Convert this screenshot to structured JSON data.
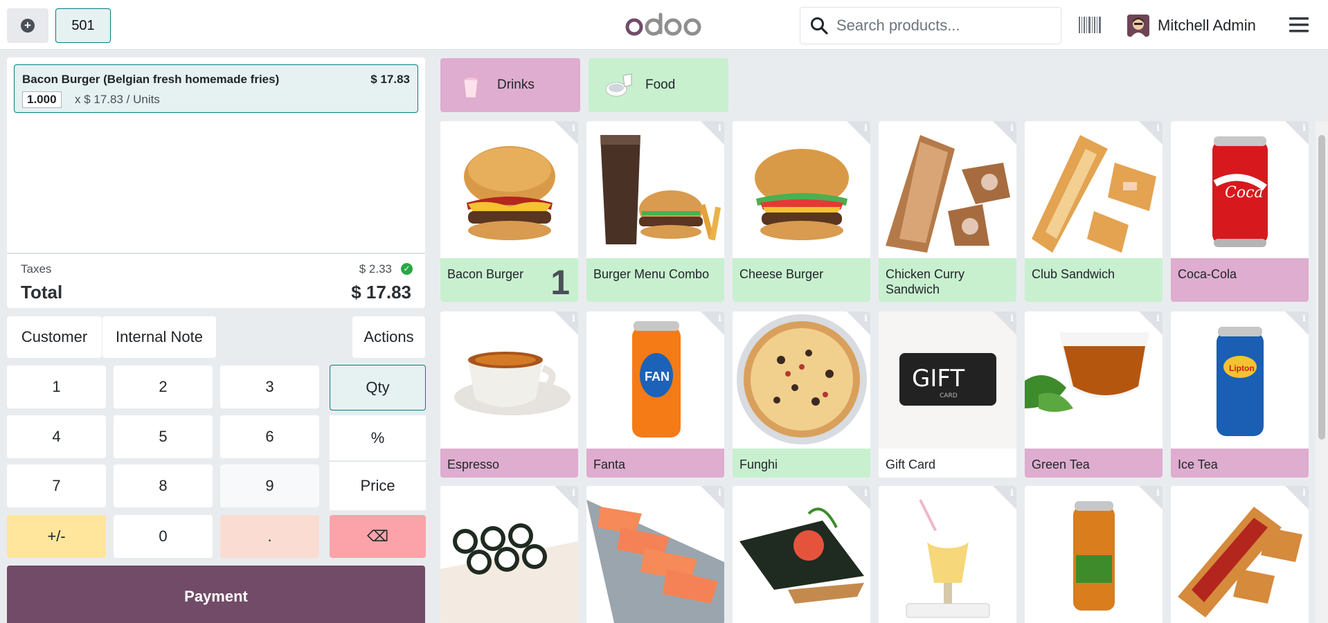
{
  "header": {
    "order_number": "501",
    "search_placeholder": "Search products...",
    "user_name": "Mitchell Admin",
    "logo_text": "odoo"
  },
  "order": {
    "lines": [
      {
        "name": "Bacon Burger (Belgian fresh homemade fries)",
        "price": "$ 17.83",
        "qty": "1.000",
        "unit": "x $ 17.83 / Units"
      }
    ],
    "taxes_label": "Taxes",
    "taxes_value": "$ 2.33",
    "total_label": "Total",
    "total_value": "$ 17.83"
  },
  "controls": {
    "customer": "Customer",
    "internal_note": "Internal Note",
    "actions": "Actions"
  },
  "numpad": {
    "keys": [
      "1",
      "2",
      "3",
      "4",
      "5",
      "6",
      "7",
      "8",
      "9",
      "+/-",
      "0",
      "."
    ],
    "modes": [
      "Qty",
      "%",
      "Price"
    ],
    "backspace": "⌫",
    "payment": "Payment"
  },
  "categories": [
    {
      "name": "Drinks",
      "color": "#deadcf",
      "icon": "milkshake-icon"
    },
    {
      "name": "Food",
      "color": "#c8f0cf",
      "icon": "food-plate-icon"
    }
  ],
  "products": [
    {
      "name": "Bacon Burger",
      "category": "food",
      "qty": "1",
      "icon": "burger-icon"
    },
    {
      "name": "Burger Menu Combo",
      "category": "food",
      "icon": "combo-icon"
    },
    {
      "name": "Cheese Burger",
      "category": "food",
      "icon": "burger-icon"
    },
    {
      "name": "Chicken Curry Sandwich",
      "category": "food",
      "icon": "sandwich-icon"
    },
    {
      "name": "Club Sandwich",
      "category": "food",
      "icon": "sandwich-icon"
    },
    {
      "name": "Coca-Cola",
      "category": "drinks",
      "icon": "can-icon"
    },
    {
      "name": "Espresso",
      "category": "drinks",
      "icon": "coffee-cup-icon"
    },
    {
      "name": "Fanta",
      "category": "drinks",
      "icon": "can-icon"
    },
    {
      "name": "Funghi",
      "category": "food",
      "icon": "pizza-icon"
    },
    {
      "name": "Gift Card",
      "category": "none",
      "icon": "gift-card-icon"
    },
    {
      "name": "Green Tea",
      "category": "drinks",
      "icon": "tea-cup-icon"
    },
    {
      "name": "Ice Tea",
      "category": "drinks",
      "icon": "can-icon"
    },
    {
      "name": "",
      "category": "food",
      "icon": "sushi-icon"
    },
    {
      "name": "",
      "category": "food",
      "icon": "salmon-icon"
    },
    {
      "name": "",
      "category": "food",
      "icon": "temaki-icon"
    },
    {
      "name": "",
      "category": "drinks",
      "icon": "milkshake-icon"
    },
    {
      "name": "",
      "category": "drinks",
      "icon": "can-icon"
    },
    {
      "name": "",
      "category": "food",
      "icon": "sandwich-icon"
    }
  ]
}
